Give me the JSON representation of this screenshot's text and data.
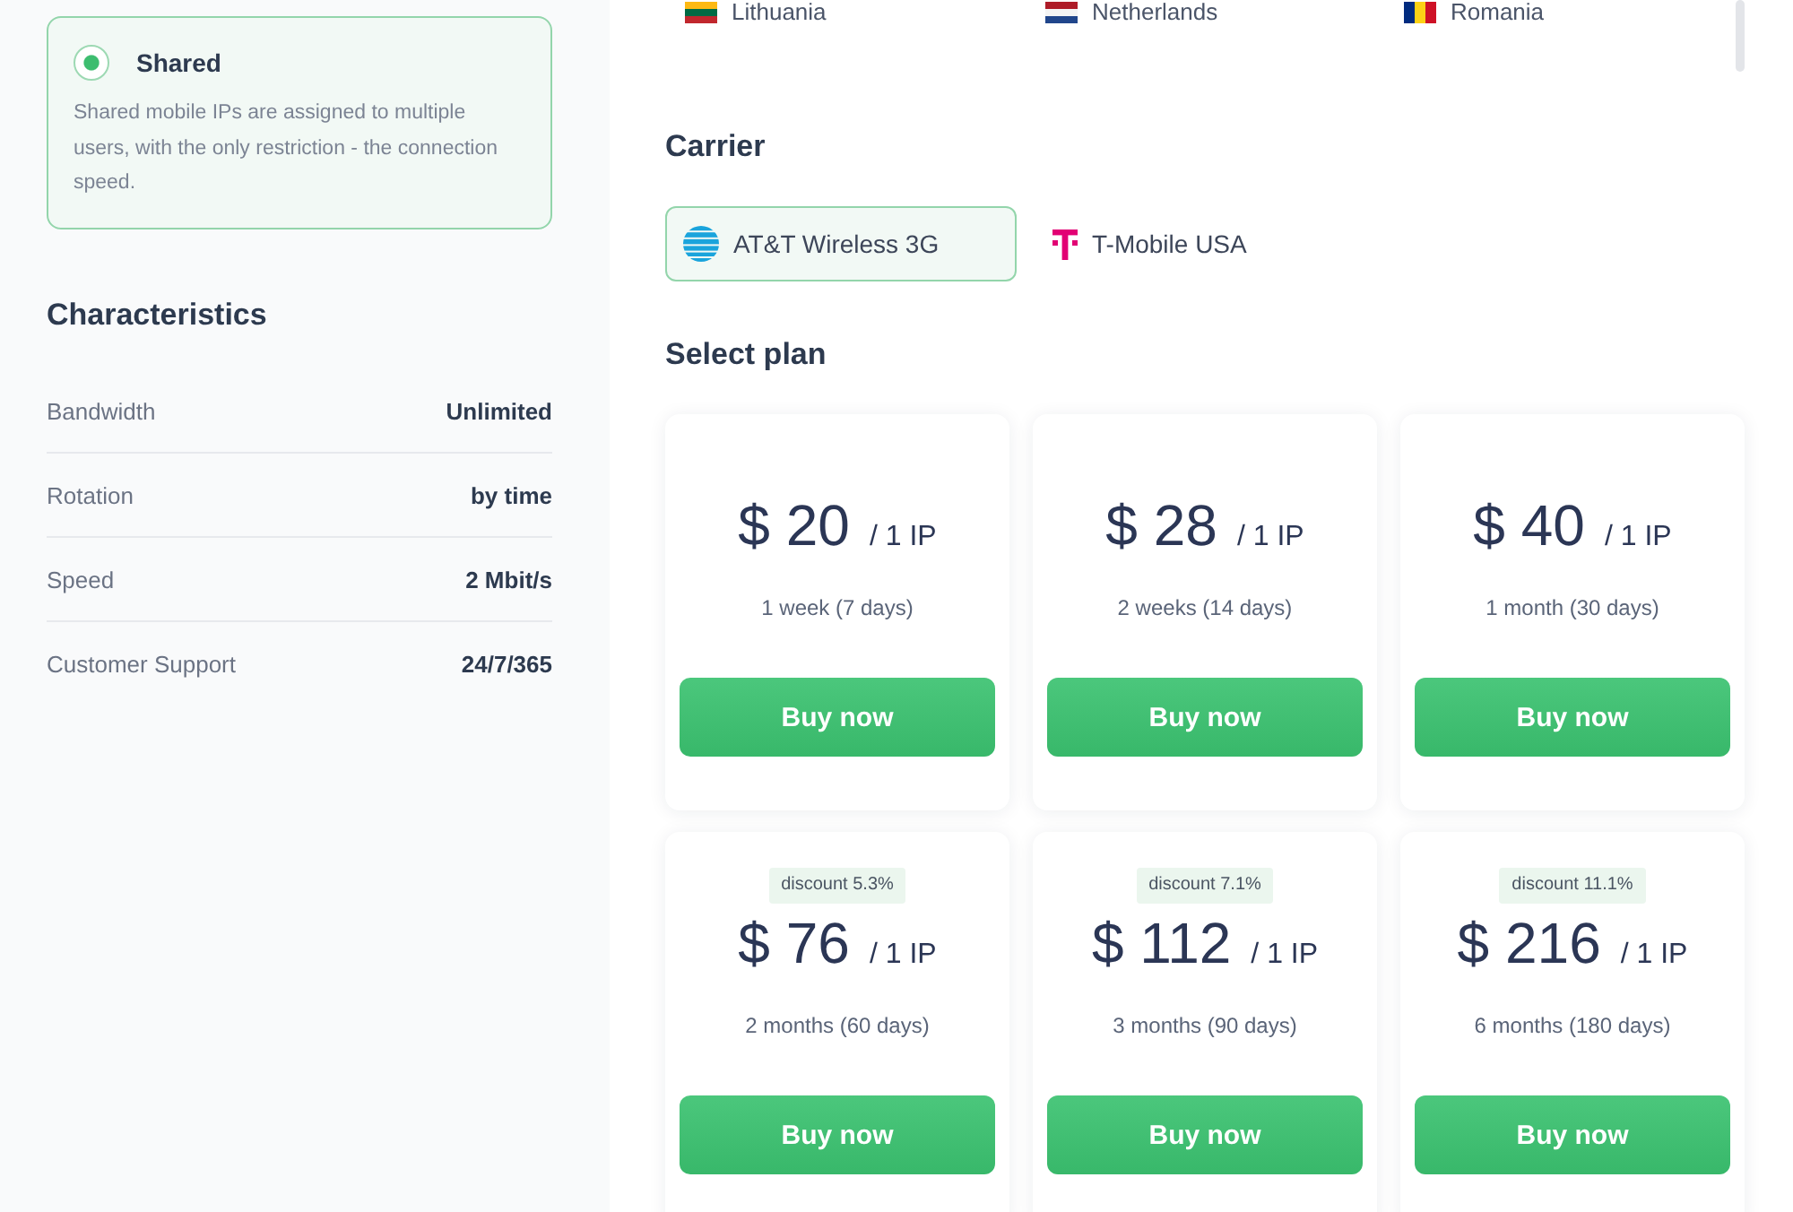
{
  "proxy_type": {
    "label": "Shared",
    "selected": true,
    "description": "Shared mobile IPs are assigned to multiple users, with the only restriction - the connection speed."
  },
  "characteristics": {
    "title": "Characteristics",
    "rows": [
      {
        "label": "Bandwidth",
        "value": "Unlimited"
      },
      {
        "label": "Rotation",
        "value": "by time"
      },
      {
        "label": "Speed",
        "value": "2 Mbit/s"
      },
      {
        "label": "Customer Support",
        "value": "24/7/365"
      }
    ]
  },
  "countries": [
    {
      "name": "Lithuania",
      "kind": "lithuania"
    },
    {
      "name": "Netherlands",
      "kind": "netherlands"
    },
    {
      "name": "Romania",
      "kind": "romania"
    }
  ],
  "carrier": {
    "title": "Carrier",
    "options": [
      {
        "name": "AT&T Wireless 3G",
        "kind": "globe",
        "selected": true
      },
      {
        "name": "T-Mobile USA",
        "kind": "tee",
        "selected": false
      }
    ]
  },
  "plans": {
    "title": "Select plan",
    "items": [
      {
        "price": "$ 20",
        "unit": "/ 1 IP",
        "duration": "1 week (7 days)",
        "button": "Buy now"
      },
      {
        "price": "$ 28",
        "unit": "/ 1 IP",
        "duration": "2 weeks (14 days)",
        "button": "Buy now"
      },
      {
        "price": "$ 40",
        "unit": "/ 1 IP",
        "duration": "1 month (30 days)",
        "button": "Buy now"
      },
      {
        "discount": "discount 5.3%",
        "price": "$ 76",
        "unit": "/ 1 IP",
        "duration": "2 months (60 days)",
        "button": "Buy now"
      },
      {
        "discount": "discount 7.1%",
        "price": "$ 112",
        "unit": "/ 1 IP",
        "duration": "3 months (90 days)",
        "button": "Buy now"
      },
      {
        "discount": "discount 11.1%",
        "price": "$ 216",
        "unit": "/ 1 IP",
        "duration": "6 months (180 days)",
        "button": "Buy now"
      }
    ]
  }
}
